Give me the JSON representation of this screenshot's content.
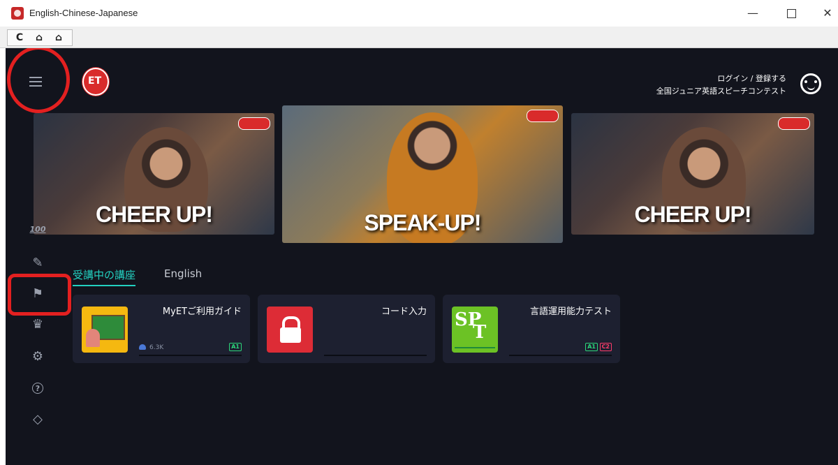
{
  "window": {
    "title": "English-Chinese-Japanese",
    "min_glyph": "—",
    "close_glyph": "✕"
  },
  "toolbar": {
    "reload_glyph": "C",
    "home_glyph": "⌂",
    "home2_glyph": "⌂"
  },
  "header": {
    "logo_text": "ET",
    "login_label": "ログイン / 登録する",
    "contest_label": "全国ジュニア英語スピーチコンテスト"
  },
  "banners": [
    {
      "caption": "CHEER UP!"
    },
    {
      "caption": "SPEAK-UP!"
    },
    {
      "caption": "CHEER UP!"
    }
  ],
  "side_nav": {
    "score_text": "100",
    "pencil": "✎",
    "flag": "⚑",
    "crown": "♛",
    "gear": "⚙",
    "help": "?",
    "tag": "◇"
  },
  "tabs": {
    "active": "受講中の講座",
    "english": "English"
  },
  "courses": [
    {
      "title": "MyETご利用ガイド",
      "count": "6.3K",
      "levels": [
        "A1"
      ]
    },
    {
      "title": "コード入力",
      "count": "",
      "levels": []
    },
    {
      "title": "言語運用能力テスト",
      "count": "",
      "levels": [
        "A1",
        "C2"
      ],
      "thumb_sp": "SP",
      "thumb_t": "T"
    }
  ],
  "colors": {
    "accent": "#23d0c0",
    "background": "#12141d",
    "card": "#1d2030",
    "highlight_ring": "#e32020"
  }
}
